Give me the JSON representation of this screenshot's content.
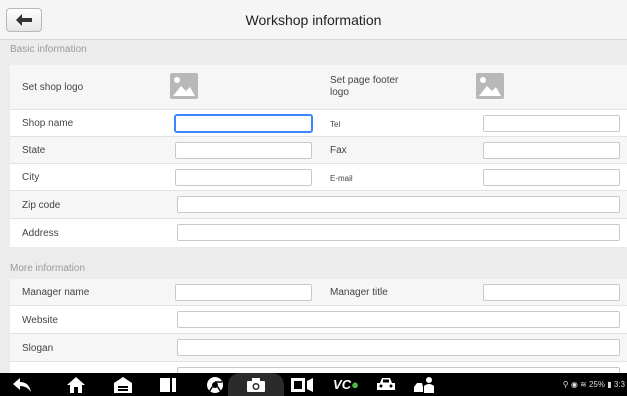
{
  "header": {
    "title": "Workshop information"
  },
  "basic": {
    "section_label": "Basic information",
    "shop_logo_label": "Set shop logo",
    "footer_logo_label": "Set page footer logo",
    "shop_name": "Shop name",
    "tel": "Tel",
    "state": "State",
    "fax": "Fax",
    "city": "City",
    "email": "E-mail",
    "zip": "Zip code",
    "address": "Address"
  },
  "more": {
    "section_label": "More information",
    "manager_name": "Manager name",
    "manager_title": "Manager title",
    "website": "Website",
    "slogan": "Slogan"
  },
  "status": {
    "text": "25%",
    "clock": "3:3"
  },
  "icons": [
    "back-icon",
    "home-icon",
    "garage-icon",
    "windows-icon",
    "browser-icon",
    "camera-icon",
    "screen-record-icon",
    "vci-icon",
    "car-icon",
    "mechanic-icon"
  ]
}
